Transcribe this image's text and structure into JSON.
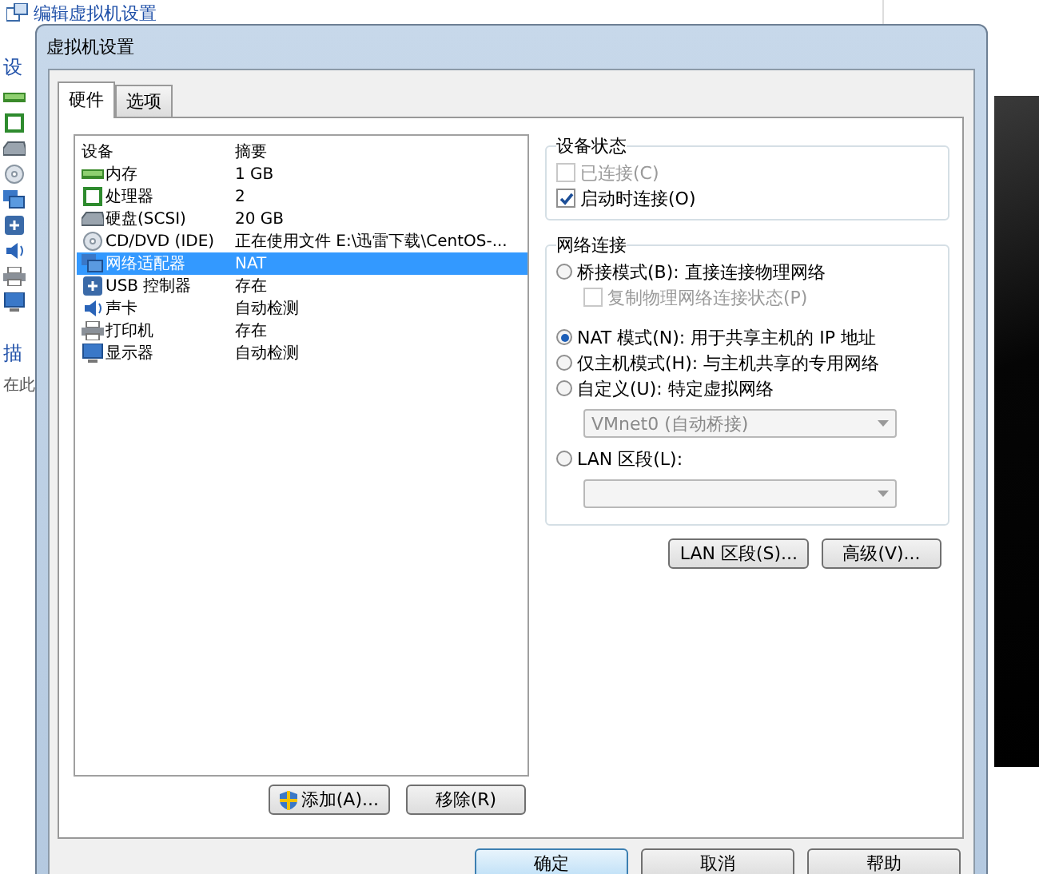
{
  "background": {
    "link": "编辑虚拟机设置",
    "heading": "设",
    "heading_2": "描",
    "description": "在此"
  },
  "window": {
    "title": "虚拟机设置"
  },
  "tabs": [
    {
      "label": "硬件",
      "selected": true
    },
    {
      "label": "选项",
      "selected": false
    }
  ],
  "device_list": {
    "columns": [
      "设备",
      "摘要"
    ],
    "rows": [
      {
        "kind": "memory",
        "device": "内存",
        "summary": "1 GB",
        "selected": false
      },
      {
        "kind": "cpu",
        "device": "处理器",
        "summary": "2",
        "selected": false
      },
      {
        "kind": "disk",
        "device": "硬盘(SCSI)",
        "summary": "20 GB",
        "selected": false
      },
      {
        "kind": "cd",
        "device": "CD/DVD (IDE)",
        "summary": "正在使用文件 E:\\迅雷下载\\CentOS-...",
        "selected": false
      },
      {
        "kind": "network",
        "device": "网络适配器",
        "summary": "NAT",
        "selected": true
      },
      {
        "kind": "usb",
        "device": "USB 控制器",
        "summary": "存在",
        "selected": false
      },
      {
        "kind": "sound",
        "device": "声卡",
        "summary": "自动检测",
        "selected": false
      },
      {
        "kind": "printer",
        "device": "打印机",
        "summary": "存在",
        "selected": false
      },
      {
        "kind": "display",
        "device": "显示器",
        "summary": "自动检测",
        "selected": false
      }
    ]
  },
  "list_buttons": [
    {
      "label": "添加(A)...",
      "shield": true
    },
    {
      "label": "移除(R)",
      "shield": false
    }
  ],
  "device_status": {
    "title": "设备状态",
    "options": [
      {
        "label": "已连接(C)",
        "checked": false,
        "disabled": true
      },
      {
        "label": "启动时连接(O)",
        "checked": true,
        "disabled": false
      }
    ]
  },
  "network": {
    "title": "网络连接",
    "options": [
      {
        "kind": "radio",
        "label": "桥接模式(B): 直接连接物理网络",
        "selected": false,
        "disabled": false
      },
      {
        "kind": "checkbox",
        "label": "复制物理网络连接状态(P)",
        "checked": false,
        "disabled": true
      },
      {
        "kind": "radio",
        "label": "NAT 模式(N): 用于共享主机的 IP 地址",
        "selected": true,
        "disabled": false
      },
      {
        "kind": "radio",
        "label": "仅主机模式(H): 与主机共享的专用网络",
        "selected": false,
        "disabled": false
      },
      {
        "kind": "radio",
        "label": "自定义(U): 特定虚拟网络",
        "selected": false,
        "disabled": false
      },
      {
        "kind": "dropdown",
        "value": "VMnet0 (自动桥接)",
        "disabled": true
      },
      {
        "kind": "radio",
        "label": "LAN 区段(L):",
        "selected": false,
        "disabled": false
      },
      {
        "kind": "dropdown",
        "disabled": true
      }
    ]
  },
  "panel_buttons": [
    "LAN 区段(S)...",
    "高级(V)..."
  ],
  "dialog_buttons": [
    {
      "label": "确定",
      "default": true
    },
    {
      "label": "取消",
      "default": false
    },
    {
      "label": "帮助",
      "default": false
    }
  ]
}
